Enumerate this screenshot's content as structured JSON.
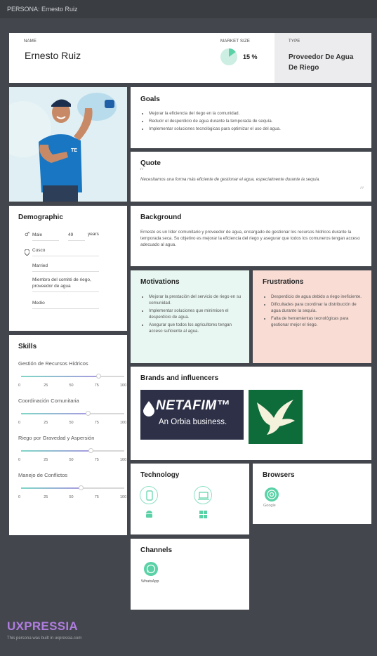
{
  "topbar": {
    "title": "PERSONA: Ernesto Ruiz"
  },
  "header": {
    "name_label": "NAME",
    "name": "Ernesto Ruiz",
    "market_label": "MARKET SIZE",
    "market_value": "15 %",
    "market_percent": 15,
    "type_label": "TYPE",
    "type_value": "Proveedor De Agua De Riego"
  },
  "goals": {
    "title": "Goals",
    "items": [
      "Mejorar la eficiencia del riego en la comunidad.",
      "Reducir el desperdicio de agua durante la temporada de sequía.",
      "Implementar soluciones tecnológicas para optimizar el uso del agua."
    ]
  },
  "quote": {
    "title": "Quote",
    "text": "Necesitamos una forma más eficiente de gestionar el agua, especialmente durante la sequía."
  },
  "demographic": {
    "title": "Demographic",
    "gender": "Male",
    "age": "49",
    "age_unit": "years",
    "location": "Cusco",
    "status": "Married",
    "role": "Miembro del comité de riego, proveedor de agua",
    "income": "Medio"
  },
  "background": {
    "title": "Background",
    "text": "Ernesto es un líder comunitario y proveedor de agua, encargado de gestionar los recursos hídricos durante la temporada seca. Su objetivo es mejorar la eficiencia del riego y asegurar que todos los comuneros tengan acceso adecuado al agua."
  },
  "motivations": {
    "title": "Motivations",
    "items": [
      "Mejorar la prestación del servicio de riego en su comunidad.",
      "Implementar soluciones que minimicen el desperdicio de agua.",
      "Asegurar que todos los agricultores tengan acceso suficiente al agua."
    ]
  },
  "frustrations": {
    "title": "Frustrations",
    "items": [
      "Desperdicio de agua debido a riego ineficiente.",
      "Dificultades para coordinar la distribución de agua durante la sequía.",
      "Falta de herramientas tecnológicas para gestionar mejor el riego."
    ]
  },
  "skills": {
    "title": "Skills",
    "ticks": [
      "0",
      "25",
      "50",
      "75",
      "100"
    ],
    "items": [
      {
        "name": "Gestión de Recursos Hídricos",
        "value": 75
      },
      {
        "name": "Coordinación Comunitaria",
        "value": 65
      },
      {
        "name": "Riego por Gravedad y Aspersión",
        "value": 68
      },
      {
        "name": "Manejo de Conflictos",
        "value": 58
      }
    ]
  },
  "brands": {
    "title": "Brands and influencers",
    "netafim_name": "NETAFIM™",
    "netafim_sub": "An Orbia business."
  },
  "technology": {
    "title": "Technology"
  },
  "browsers": {
    "title": "Browsers",
    "google_label": "Google"
  },
  "channels": {
    "title": "Channels",
    "whatsapp_label": "WhatsApp"
  },
  "footer": {
    "brand": "UXPRESSIA",
    "note": "This persona was built in uxpressia.com"
  },
  "colors": {
    "accent_mint": "#5ad1a6",
    "motivation_bg": "#e8f7f2",
    "frustration_bg": "#f9ddd5",
    "brand_purple": "#b07de0"
  }
}
